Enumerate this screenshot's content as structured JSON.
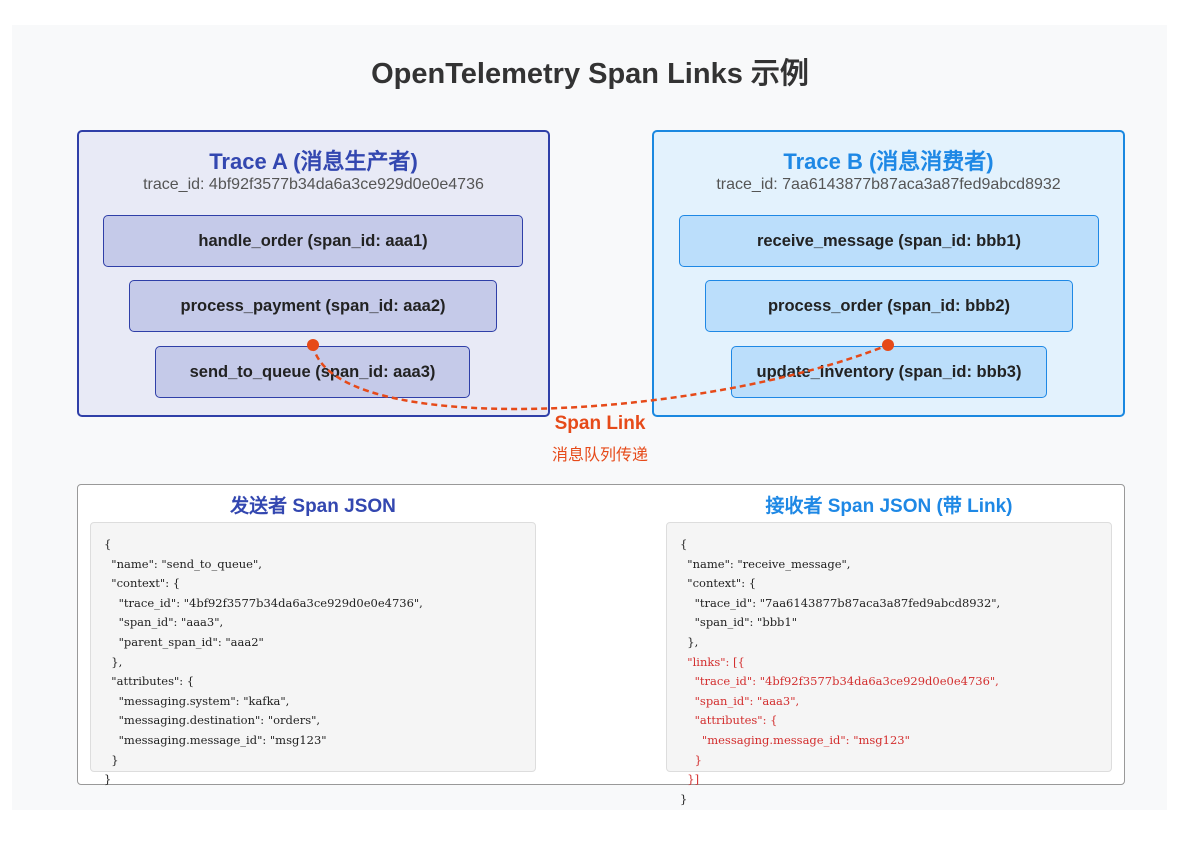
{
  "title": "OpenTelemetry Span Links 示例",
  "trace_a": {
    "name": "Trace A (消息生产者)",
    "trace_id": "trace_id: 4bf92f3577b34da6a3ce929d0e0e4736",
    "spans": [
      "handle_order (span_id: aaa1)",
      "process_payment (span_id: aaa2)",
      "send_to_queue (span_id: aaa3)"
    ]
  },
  "trace_b": {
    "name": "Trace B (消息消费者)",
    "trace_id": "trace_id: 7aa6143877b87aca3a87fed9abcd8932",
    "spans": [
      "receive_message (span_id: bbb1)",
      "process_order (span_id: bbb2)",
      "update_inventory (span_id: bbb3)"
    ]
  },
  "link": {
    "label": "Span Link",
    "sublabel": "消息队列传递"
  },
  "json_sender": {
    "title": "发送者 Span JSON",
    "lines": [
      "{",
      "  \"name\": \"send_to_queue\",",
      "  \"context\": {",
      "    \"trace_id\": \"4bf92f3577b34da6a3ce929d0e0e4736\",",
      "    \"span_id\": \"aaa3\",",
      "    \"parent_span_id\": \"aaa2\"",
      "  },",
      "  \"attributes\": {",
      "    \"messaging.system\": \"kafka\",",
      "    \"messaging.destination\": \"orders\",",
      "    \"messaging.message_id\": \"msg123\"",
      "  }",
      "}"
    ]
  },
  "json_receiver": {
    "title": "接收者 Span JSON (带 Link)",
    "lines": [
      "{",
      "  \"name\": \"receive_message\",",
      "  \"context\": {",
      "    \"trace_id\": \"7aa6143877b87aca3a87fed9abcd8932\",",
      "    \"span_id\": \"bbb1\"",
      "  },",
      "  \"links\": [{",
      "    \"trace_id\": \"4bf92f3577b34da6a3ce929d0e0e4736\",",
      "    \"span_id\": \"aaa3\",",
      "    \"attributes\": {",
      "      \"messaging.message_id\": \"msg123\"",
      "    }",
      "  }]",
      "}"
    ],
    "highlight_lines": [
      6,
      7,
      8,
      9,
      10,
      11,
      12
    ]
  },
  "colors": {
    "trace_a": "#3347b0",
    "trace_b": "#1e88e5",
    "link": "#e64a19",
    "highlight": "#d32f2f"
  }
}
